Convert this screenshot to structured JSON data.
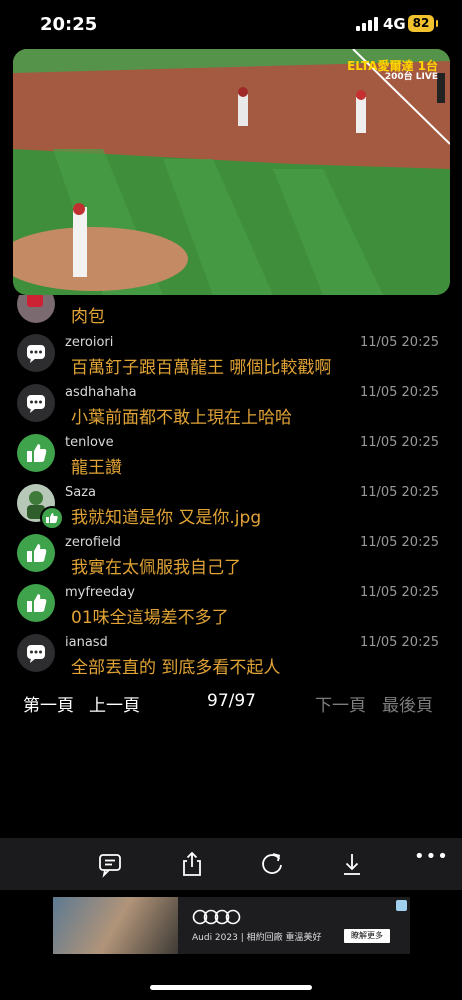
{
  "status": {
    "time": "20:25",
    "network": "4G",
    "battery": "82"
  },
  "video": {
    "logo_brand": "ELTA愛爾達 1台",
    "logo_sub": "200台 LIVE"
  },
  "comments": {
    "partial_text": "肉包",
    "items": [
      {
        "user": "zeroiori",
        "time": "11/05 20:25",
        "text": "百萬釘子跟百萬龍王 哪個比較戳啊",
        "avatar": "chat-bubble-icon"
      },
      {
        "user": "asdhahaha",
        "time": "11/05 20:25",
        "text": "小葉前面都不敢上現在上哈哈",
        "avatar": "chat-bubble-icon"
      },
      {
        "user": "tenlove",
        "time": "11/05 20:25",
        "text": "龍王讚",
        "avatar": "thumbs-up-icon"
      },
      {
        "user": "Saza",
        "time": "11/05 20:25",
        "text": "我就知道是你 又是你.jpg",
        "avatar": "user-photo"
      },
      {
        "user": "zerofield",
        "time": "11/05 20:25",
        "text": "我實在太佩服我自己了",
        "avatar": "thumbs-up-icon"
      },
      {
        "user": "myfreeday",
        "time": "11/05 20:25",
        "text": "01味全這場差不多了",
        "avatar": "thumbs-up-icon"
      },
      {
        "user": "ianasd",
        "time": "11/05 20:25",
        "text": "全部丟直的 到底多看不起人",
        "avatar": "chat-bubble-icon"
      }
    ]
  },
  "pager": {
    "first": "第一頁",
    "prev": "上一頁",
    "count": "97/97",
    "next": "下一頁",
    "last": "最後頁"
  },
  "toolbar": {
    "icons": [
      "comment-icon",
      "share-icon",
      "refresh-icon",
      "download-icon",
      "more-icon"
    ],
    "more": "•••"
  },
  "ad": {
    "text": "Audi 2023 | 相約回廠 重溫美好",
    "cta": "瞭解更多"
  }
}
